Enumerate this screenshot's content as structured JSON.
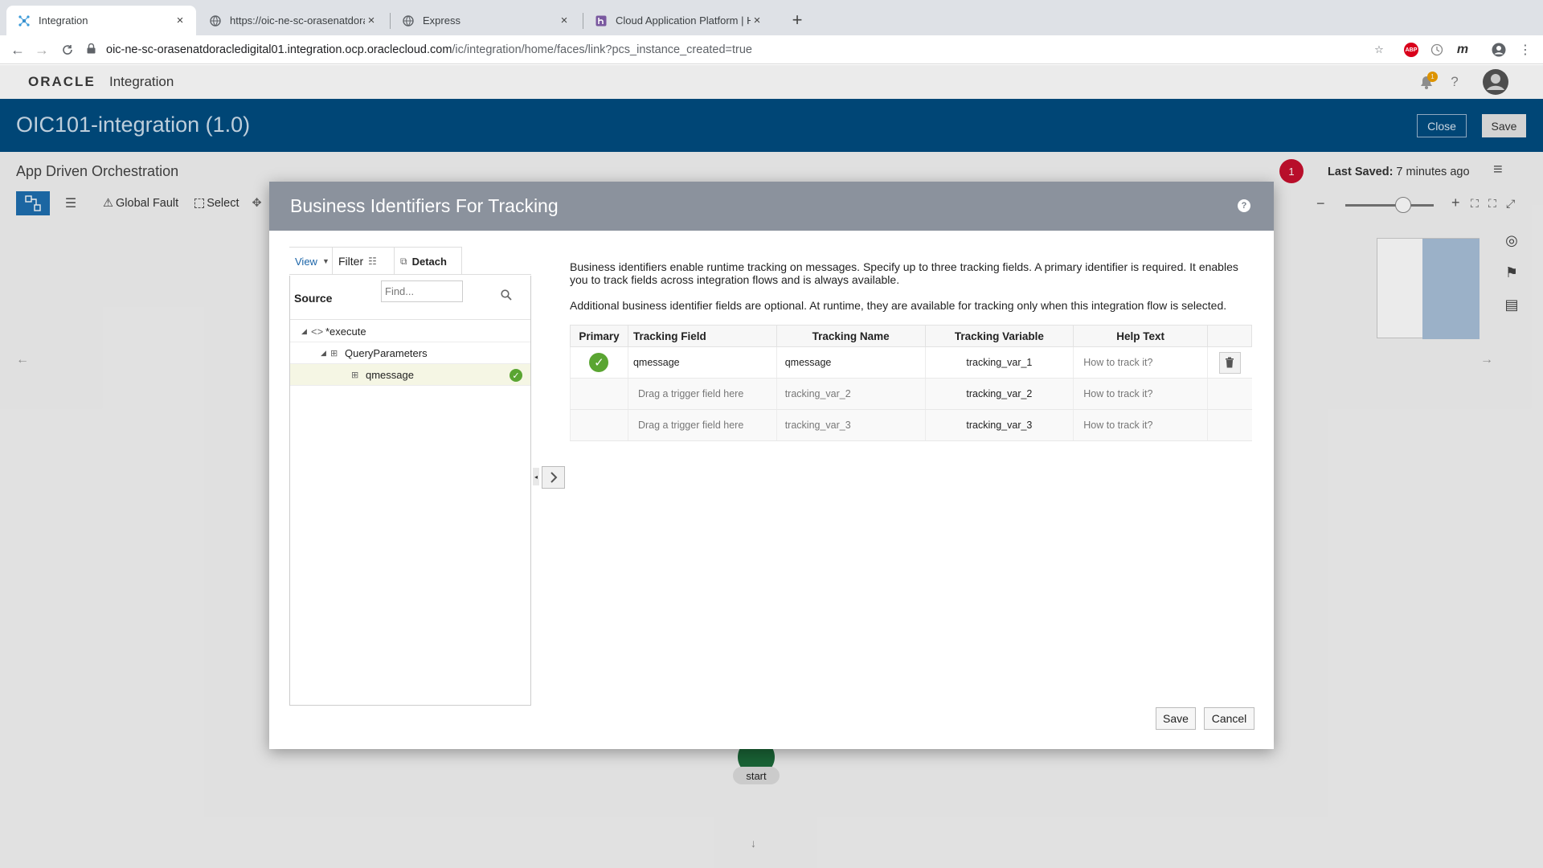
{
  "browser": {
    "tabs": [
      {
        "label": "Integration",
        "icon": "oracle-integration-favicon",
        "close": "×"
      },
      {
        "label": "https://oic-ne-sc-orasenatdora",
        "icon": "globe-icon",
        "close": "×"
      },
      {
        "label": "Express",
        "icon": "globe-icon",
        "close": "×"
      },
      {
        "label": "Cloud Application Platform | He",
        "icon": "heroku-icon",
        "close": "×"
      }
    ],
    "new_tab": "+",
    "url_host": "oic-ne-sc-orasenatdoracledigital01.integration.ocp.oraclecloud.com",
    "url_path": "/ic/integration/home/faces/link?pcs_instance_created=true",
    "abp_label": "ABP",
    "ext_m": "m"
  },
  "app": {
    "logo_text": "ORACLE",
    "product": "Integration",
    "notification_count": "1",
    "help": "?",
    "title": "OIC101-integration (1.0)",
    "close_label": "Close",
    "save_label": "Save",
    "accent": "#004d80"
  },
  "canvas": {
    "subheader": "App Driven Orchestration",
    "error_count": "1",
    "last_saved_label": "Last Saved:",
    "last_saved_value": " 7 minutes ago",
    "tools": {
      "global_fault": "Global Fault",
      "select": "Select"
    },
    "start_node": "start"
  },
  "dialog": {
    "title": "Business Identifiers For Tracking",
    "help": "?",
    "source_tabs": {
      "view": "View",
      "filter": "Filter",
      "detach": "Detach"
    },
    "source_label": "Source",
    "find_placeholder": "Find...",
    "tree": [
      {
        "label": "*execute",
        "level": 0
      },
      {
        "label": "QueryParameters",
        "level": 1
      },
      {
        "label": "qmessage",
        "level": 2,
        "selected": true
      }
    ],
    "description_1": "Business identifiers enable runtime tracking on messages. Specify up to three tracking fields. A primary identifier is required. It enables you to track fields across integration flows and is always available.",
    "description_2": "Additional business identifier fields are optional. At runtime, they are available for tracking only when this integration flow is selected.",
    "columns": [
      "Primary",
      "Tracking Field",
      "Tracking Name",
      "Tracking Variable",
      "Help Text"
    ],
    "rows": [
      {
        "primary": true,
        "field": "qmessage",
        "name": "qmessage",
        "variable": "tracking_var_1",
        "help": "How to track it?"
      },
      {
        "primary": false,
        "field": "Drag a trigger field here",
        "name": "tracking_var_2",
        "variable": "tracking_var_2",
        "help": "How to track it?"
      },
      {
        "primary": false,
        "field": "Drag a trigger field here",
        "name": "tracking_var_3",
        "variable": "tracking_var_3",
        "help": "How to track it?"
      }
    ],
    "save_label": "Save",
    "cancel_label": "Cancel",
    "success_color": "#5aa532"
  }
}
